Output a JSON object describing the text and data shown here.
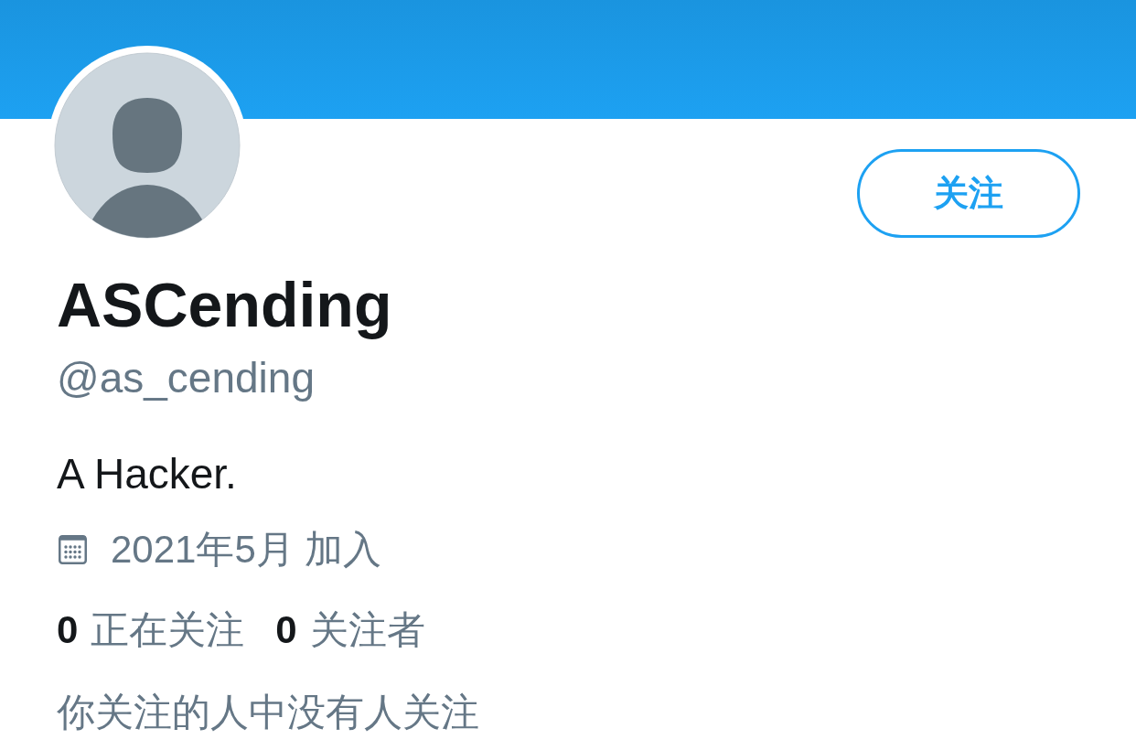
{
  "profile": {
    "follow_button": {
      "label": "关注"
    },
    "display_name": "ASCending",
    "handle": "@as_cending",
    "bio": "A Hacker.",
    "joined": "2021年5月 加入",
    "stats": [
      {
        "count": "0",
        "label": "正在关注"
      },
      {
        "count": "0",
        "label": "关注者"
      }
    ],
    "followers_you_know": "你关注的人中没有人关注"
  }
}
